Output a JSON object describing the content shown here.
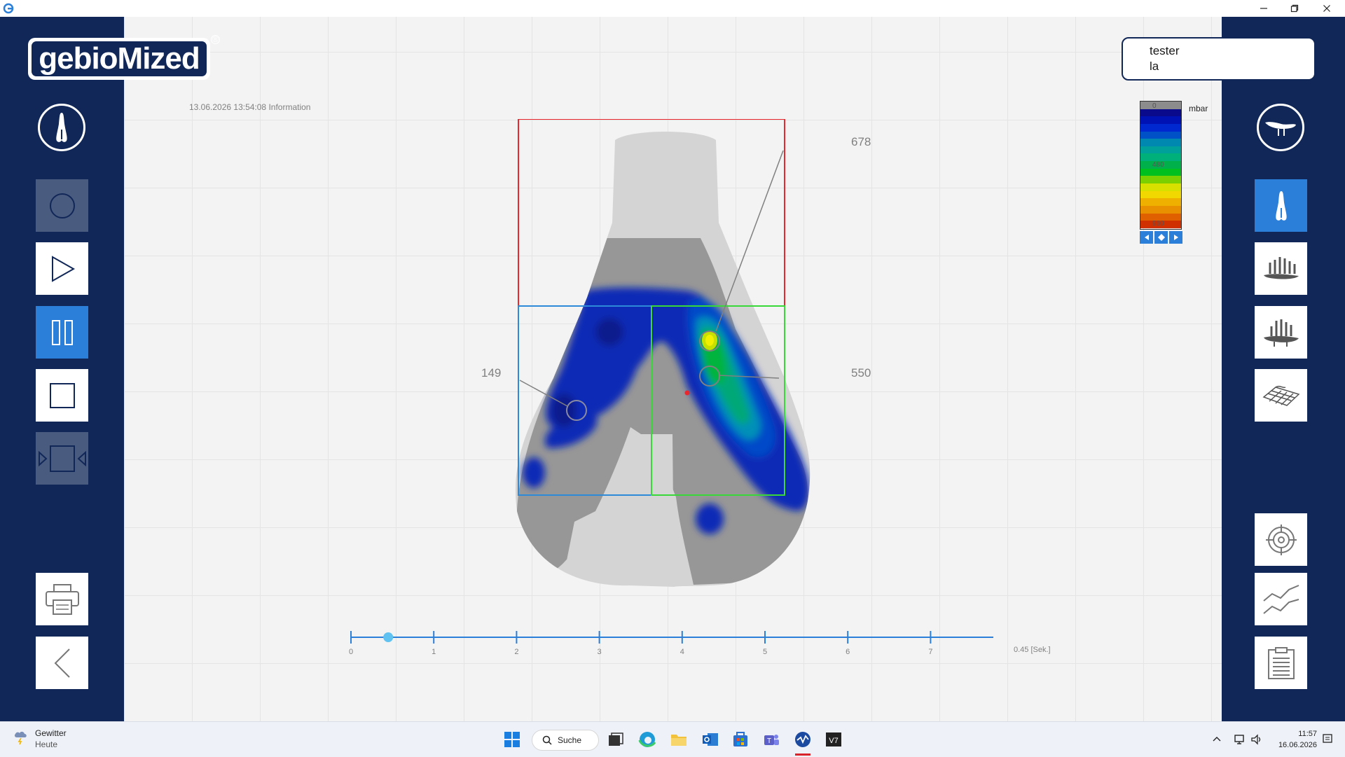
{
  "window": {
    "minimize_icon": "minimize-icon",
    "maximize_icon": "restore-icon",
    "close_icon": "close-icon"
  },
  "logo": {
    "text": "gebioMized",
    "trademark": "®"
  },
  "timestamp": "13.06.2026 13:54:08 Information",
  "user": {
    "line1": "tester",
    "line2": "la"
  },
  "scale": {
    "unit": "mbar",
    "labels": [
      "0",
      "480",
      "960"
    ],
    "colors": [
      "#8c8c8c",
      "#0a0a8c",
      "#0012b4",
      "#0028d0",
      "#0050c8",
      "#0088b0",
      "#00a09a",
      "#00b07a",
      "#00b04a",
      "#00c020",
      "#7ad000",
      "#d8e000",
      "#f0d800",
      "#f0b000",
      "#e89000",
      "#e06000",
      "#d03000"
    ]
  },
  "pressure_map": {
    "label_top_right": "678",
    "label_mid_right": "550",
    "label_mid_left": "149"
  },
  "timeline": {
    "ticks": [
      "0",
      "1",
      "2",
      "3",
      "4",
      "5",
      "6",
      "7"
    ],
    "readout": "0.45 [Sek.]",
    "position_seconds": 0.45
  },
  "taskbar": {
    "weather_title": "Gewitter",
    "weather_sub": "Heute",
    "search_label": "Suche",
    "time": "11:57",
    "date": "16.06.2026"
  }
}
